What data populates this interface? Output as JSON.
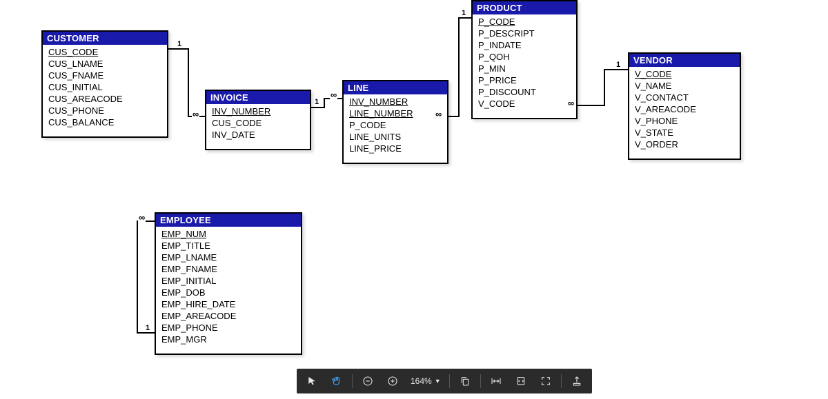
{
  "entities": {
    "customer": {
      "title": "CUSTOMER",
      "fields": [
        "CUS_CODE",
        "CUS_LNAME",
        "CUS_FNAME",
        "CUS_INITIAL",
        "CUS_AREACODE",
        "CUS_PHONE",
        "CUS_BALANCE"
      ],
      "pk_index": 0
    },
    "invoice": {
      "title": "INVOICE",
      "fields": [
        "INV_NUMBER",
        "CUS_CODE",
        "INV_DATE"
      ],
      "pk_index": 0
    },
    "line": {
      "title": "LINE",
      "fields": [
        "INV_NUMBER",
        "LINE_NUMBER",
        "P_CODE",
        "LINE_UNITS",
        "LINE_PRICE"
      ],
      "pk_index": 1
    },
    "product": {
      "title": "PRODUCT",
      "fields": [
        "P_CODE",
        "P_DESCRIPT",
        "P_INDATE",
        "P_QOH",
        "P_MIN",
        "P_PRICE",
        "P_DISCOUNT",
        "V_CODE"
      ],
      "pk_index": 0
    },
    "vendor": {
      "title": "VENDOR",
      "fields": [
        "V_CODE",
        "V_NAME",
        "V_CONTACT",
        "V_AREACODE",
        "V_PHONE",
        "V_STATE",
        "V_ORDER"
      ],
      "pk_index": 0
    },
    "employee": {
      "title": "EMPLOYEE",
      "fields": [
        "EMP_NUM",
        "EMP_TITLE",
        "EMP_LNAME",
        "EMP_FNAME",
        "EMP_INITIAL",
        "EMP_DOB",
        "EMP_HIRE_DATE",
        "EMP_AREACODE",
        "EMP_PHONE",
        "EMP_MGR"
      ],
      "pk_index": 0
    }
  },
  "cardinality": {
    "one": "1",
    "many": "∞"
  },
  "toolbar": {
    "zoom": "164%"
  }
}
